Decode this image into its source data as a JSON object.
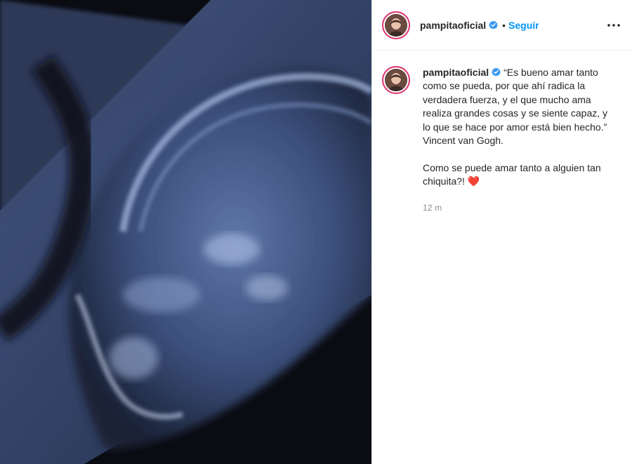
{
  "post": {
    "username": "pampitaoficial",
    "verified": true,
    "follow_label": "Seguir",
    "header_separator": "•",
    "more_icon": "more-horizontal-icon",
    "caption": "“Es bueno amar tanto como se pueda, por que ahí radica la verdadera fuerza, y el que mucho ama realiza grandes cosas y se siente capaz, y lo que se hace por amor está bien hecho.”\nVincent van Gogh.\n\nComo se puede amar tanto a alguien tan chiquita?! ❤️",
    "timestamp": "12 m"
  },
  "colors": {
    "accent": "#0095f6",
    "verified": "#3897f0",
    "story_ring": "#e1306c",
    "muted": "#8e8e8e"
  },
  "media": {
    "kind": "ultrasound-photo"
  }
}
